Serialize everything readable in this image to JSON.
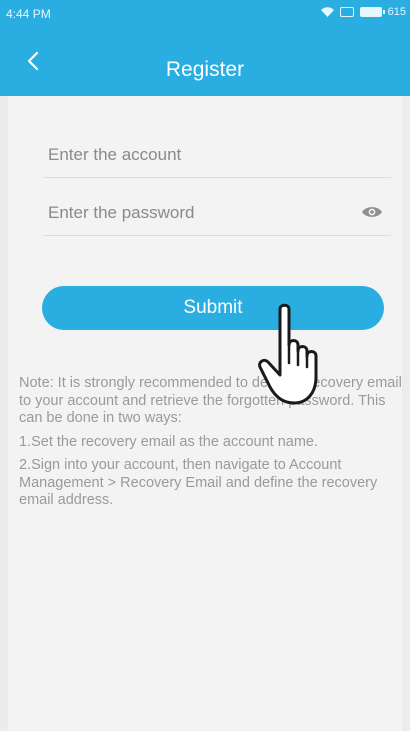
{
  "status_bar": {
    "time": "4:44 PM",
    "battery_text": "615",
    "icons": [
      "wifi-icon",
      "sim-icon",
      "battery-icon"
    ]
  },
  "header": {
    "title": "Register",
    "back_icon": "chevron-left-icon"
  },
  "form": {
    "account_placeholder": "Enter the account",
    "password_placeholder": "Enter the password",
    "password_toggle_icon": "eye-icon",
    "submit_label": "Submit"
  },
  "note": {
    "intro": "Note: It is strongly recommended to define a recovery email to your account and retrieve the forgotten password. This can be done in two ways:",
    "way1": "1.Set the recovery email as the account name.",
    "way2": "2.Sign into your account, then navigate to Account Management > Recovery Email and define the recovery email address."
  },
  "overlay": {
    "pointer_icon": "hand-pointer-icon"
  },
  "colors": {
    "accent": "#2aaee2",
    "background": "#f3f3f3",
    "note_text": "#9a9a9a"
  }
}
